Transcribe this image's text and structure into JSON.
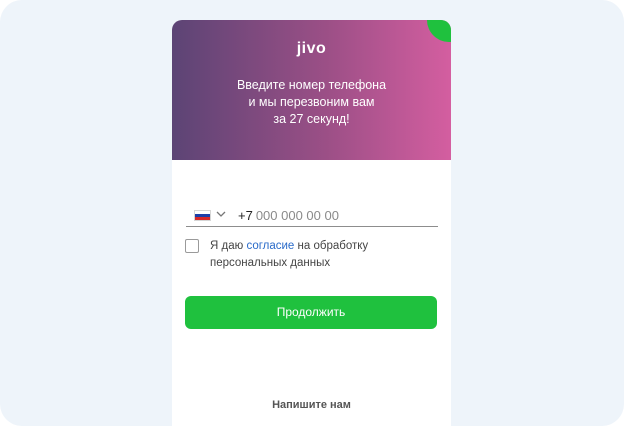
{
  "brand": {
    "logo": "jivo",
    "accent_color": "#1fc13e",
    "gradient": [
      "#5c4475",
      "#d45ea0"
    ]
  },
  "header": {
    "headline": "Введите номер телефона\nи мы перезвоним вам\nза 27 секунд!"
  },
  "phone": {
    "country_icon": "russia-flag-icon",
    "dropdown_icon": "chevron-down-icon",
    "code": "+7",
    "placeholder": "000 000 00 00"
  },
  "consent": {
    "prefix": "Я даю ",
    "link": "согласие",
    "suffix": " на обработку персональных данных"
  },
  "actions": {
    "continue_label": "Продолжить",
    "write_us_label": "Напишите нам"
  }
}
